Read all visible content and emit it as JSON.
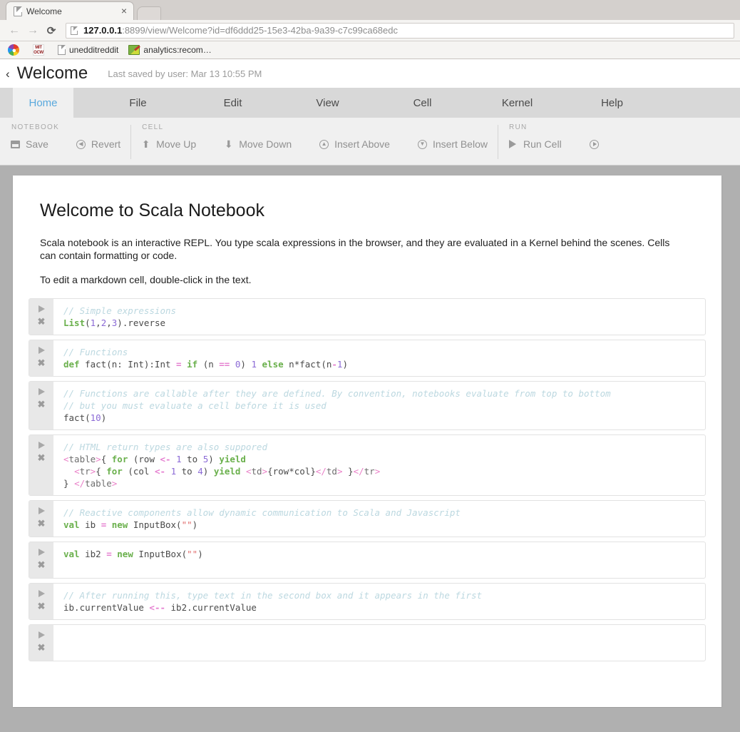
{
  "browser": {
    "tab": {
      "title": "Welcome",
      "close_label": "×",
      "favicon": "document-icon"
    },
    "nav": {
      "back": "←",
      "forward": "→",
      "reload": "⟳"
    },
    "omnibox": {
      "host": "127.0.0.1",
      "rest": ":8899/view/Welcome?id=df6ddd25-15e3-42ba-9a39-c7c99ca68edc",
      "full_url": "127.0.0.1:8899/view/Welcome?id=df6ddd25-15e3-42ba-9a39-c7c99ca68edc"
    },
    "bookmarks": [
      {
        "label": "",
        "icon": "rainbow-icon"
      },
      {
        "label": "",
        "icon": "mit-ocw-icon",
        "icon_text_top": "MIT",
        "icon_text_bottom": "OCW"
      },
      {
        "label": "unedditreddit",
        "icon": "document-icon"
      },
      {
        "label": "analytics:recom…",
        "icon": "notebook-pencil-icon"
      }
    ]
  },
  "app": {
    "header": {
      "back_icon": "‹",
      "title": "Welcome",
      "saved_status": "Last saved by user: Mar 13 10:55 PM"
    },
    "menu_tabs": [
      {
        "label": "Home",
        "active": true
      },
      {
        "label": "File",
        "active": false
      },
      {
        "label": "Edit",
        "active": false
      },
      {
        "label": "View",
        "active": false
      },
      {
        "label": "Cell",
        "active": false
      },
      {
        "label": "Kernel",
        "active": false
      },
      {
        "label": "Help",
        "active": false
      }
    ],
    "ribbon": [
      {
        "group": "NOTEBOOK",
        "items": [
          {
            "label": "Save",
            "icon": "save-disk-icon"
          },
          {
            "label": "Revert",
            "icon": "revert-circle-icon"
          }
        ]
      },
      {
        "group": "CELL",
        "items": [
          {
            "label": "Move Up",
            "icon": "arrow-up-icon"
          },
          {
            "label": "Move Down",
            "icon": "arrow-down-icon"
          },
          {
            "label": "Insert Above",
            "icon": "insert-above-icon"
          },
          {
            "label": "Insert Below",
            "icon": "insert-below-icon"
          }
        ]
      },
      {
        "group": "RUN",
        "items": [
          {
            "label": "Run Cell",
            "icon": "play-icon"
          },
          {
            "label": "",
            "icon": "play-circle-icon"
          }
        ]
      }
    ],
    "notebook": {
      "markdown": {
        "heading": "Welcome to Scala Notebook",
        "paragraphs": [
          "Scala notebook is an interactive REPL. You type scala expressions in the browser, and they are evaluated in a Kernel behind the scenes. Cells can contain formatting or code.",
          "To edit a markdown cell, double-click in the text."
        ]
      },
      "gutter": {
        "run_icon": "play-icon",
        "delete_icon": "✖"
      },
      "cells": [
        {
          "source": "// Simple expressions\nList(1,2,3).reverse",
          "lines": [
            [
              {
                "t": "// Simple expressions",
                "c": "cm"
              }
            ],
            [
              {
                "t": "List",
                "c": "kw"
              },
              {
                "t": "(",
                "c": "pl"
              },
              {
                "t": "1",
                "c": "num"
              },
              {
                "t": ",",
                "c": "pl"
              },
              {
                "t": "2",
                "c": "num"
              },
              {
                "t": ",",
                "c": "pl"
              },
              {
                "t": "3",
                "c": "num"
              },
              {
                "t": ").reverse",
                "c": "pl"
              }
            ]
          ]
        },
        {
          "source": "// Functions\ndef fact(n: Int):Int = if (n == 0) 1 else n*fact(n-1)",
          "lines": [
            [
              {
                "t": "// Functions",
                "c": "cm"
              }
            ],
            [
              {
                "t": "def",
                "c": "kw"
              },
              {
                "t": " fact(n: Int):Int ",
                "c": "pl"
              },
              {
                "t": "=",
                "c": "op"
              },
              {
                "t": " ",
                "c": "pl"
              },
              {
                "t": "if",
                "c": "kw"
              },
              {
                "t": " (n ",
                "c": "pl"
              },
              {
                "t": "==",
                "c": "op"
              },
              {
                "t": " ",
                "c": "pl"
              },
              {
                "t": "0",
                "c": "num"
              },
              {
                "t": ") ",
                "c": "pl"
              },
              {
                "t": "1",
                "c": "num"
              },
              {
                "t": " ",
                "c": "pl"
              },
              {
                "t": "else",
                "c": "kw"
              },
              {
                "t": " n*fact(n",
                "c": "pl"
              },
              {
                "t": "-",
                "c": "op"
              },
              {
                "t": "1",
                "c": "num"
              },
              {
                "t": ")",
                "c": "pl"
              }
            ]
          ]
        },
        {
          "source": "// Functions are callable after they are defined. By convention, notebooks evaluate from top to bottom\n// but you must evaluate a cell before it is used\nfact(10)",
          "lines": [
            [
              {
                "t": "// Functions are callable after they are defined. By convention, notebooks evaluate from top to bottom",
                "c": "cm"
              }
            ],
            [
              {
                "t": "// but you must evaluate a cell before it is used",
                "c": "cm"
              }
            ],
            [
              {
                "t": "fact(",
                "c": "pl"
              },
              {
                "t": "10",
                "c": "num"
              },
              {
                "t": ")",
                "c": "pl"
              }
            ]
          ]
        },
        {
          "source": "// HTML return types are also suppored\n<table>{ for (row <- 1 to 5) yield\n  <tr>{ for (col <- 1 to 4) yield <td>{row*col}</td> }</tr>\n} </table>",
          "lines": [
            [
              {
                "t": "// HTML return types are also suppored",
                "c": "cm"
              }
            ],
            [
              {
                "t": "<",
                "c": "tag"
              },
              {
                "t": "table",
                "c": "tagname"
              },
              {
                "t": ">",
                "c": "tag"
              },
              {
                "t": "{ ",
                "c": "pl"
              },
              {
                "t": "for",
                "c": "kw"
              },
              {
                "t": " (row ",
                "c": "pl"
              },
              {
                "t": "<-",
                "c": "op"
              },
              {
                "t": " ",
                "c": "pl"
              },
              {
                "t": "1",
                "c": "num"
              },
              {
                "t": " to ",
                "c": "pl"
              },
              {
                "t": "5",
                "c": "num"
              },
              {
                "t": ") ",
                "c": "pl"
              },
              {
                "t": "yield",
                "c": "kw"
              }
            ],
            [
              {
                "t": "  ",
                "c": "pl"
              },
              {
                "t": "<",
                "c": "tag"
              },
              {
                "t": "tr",
                "c": "tagname"
              },
              {
                "t": ">",
                "c": "tag"
              },
              {
                "t": "{ ",
                "c": "pl"
              },
              {
                "t": "for",
                "c": "kw"
              },
              {
                "t": " (col ",
                "c": "pl"
              },
              {
                "t": "<-",
                "c": "op"
              },
              {
                "t": " ",
                "c": "pl"
              },
              {
                "t": "1",
                "c": "num"
              },
              {
                "t": " to ",
                "c": "pl"
              },
              {
                "t": "4",
                "c": "num"
              },
              {
                "t": ") ",
                "c": "pl"
              },
              {
                "t": "yield",
                "c": "kw"
              },
              {
                "t": " ",
                "c": "pl"
              },
              {
                "t": "<",
                "c": "tag"
              },
              {
                "t": "td",
                "c": "tagname"
              },
              {
                "t": ">",
                "c": "tag"
              },
              {
                "t": "{row*col}",
                "c": "pl"
              },
              {
                "t": "</",
                "c": "tag"
              },
              {
                "t": "td",
                "c": "tagname"
              },
              {
                "t": ">",
                "c": "tag"
              },
              {
                "t": " }",
                "c": "pl"
              },
              {
                "t": "</",
                "c": "tag"
              },
              {
                "t": "tr",
                "c": "tagname"
              },
              {
                "t": ">",
                "c": "tag"
              }
            ],
            [
              {
                "t": "} ",
                "c": "pl"
              },
              {
                "t": "</",
                "c": "tag"
              },
              {
                "t": "table",
                "c": "tagname"
              },
              {
                "t": ">",
                "c": "tag"
              }
            ]
          ]
        },
        {
          "source": "// Reactive components allow dynamic communication to Scala and Javascript\nval ib = new InputBox(\"\")",
          "lines": [
            [
              {
                "t": "// Reactive components allow dynamic communication to Scala and Javascript",
                "c": "cm"
              }
            ],
            [
              {
                "t": "val",
                "c": "kw"
              },
              {
                "t": " ib ",
                "c": "pl"
              },
              {
                "t": "=",
                "c": "op"
              },
              {
                "t": " ",
                "c": "pl"
              },
              {
                "t": "new",
                "c": "kw"
              },
              {
                "t": " InputBox(",
                "c": "pl"
              },
              {
                "t": "\"\"",
                "c": "str"
              },
              {
                "t": ")",
                "c": "pl"
              }
            ]
          ]
        },
        {
          "source": "val ib2 = new InputBox(\"\")",
          "lines": [
            [
              {
                "t": "val",
                "c": "kw"
              },
              {
                "t": " ib2 ",
                "c": "pl"
              },
              {
                "t": "=",
                "c": "op"
              },
              {
                "t": " ",
                "c": "pl"
              },
              {
                "t": "new",
                "c": "kw"
              },
              {
                "t": " InputBox(",
                "c": "pl"
              },
              {
                "t": "\"\"",
                "c": "str"
              },
              {
                "t": ")",
                "c": "pl"
              }
            ]
          ]
        },
        {
          "source": "// After running this, type text in the second box and it appears in the first\nib.currentValue <-- ib2.currentValue",
          "lines": [
            [
              {
                "t": "// After running this, type text in the second box and it appears in the first",
                "c": "cm"
              }
            ],
            [
              {
                "t": "ib.currentValue ",
                "c": "pl"
              },
              {
                "t": "<--",
                "c": "op"
              },
              {
                "t": " ib2.currentValue",
                "c": "pl"
              }
            ]
          ]
        },
        {
          "source": "",
          "lines": []
        }
      ]
    }
  },
  "colors": {
    "accent_tab": "#5aa9dd",
    "page_bg": "#b0b0b0",
    "ribbon_bg": "#f0f0f0",
    "menubar_bg": "#d8d8d8",
    "comment": "#bcd8e0",
    "keyword": "#6ab04c",
    "number": "#8b6ad6",
    "operator": "#e57fd0",
    "string": "#e06c6c",
    "xml_tag": "#ea80c8"
  }
}
